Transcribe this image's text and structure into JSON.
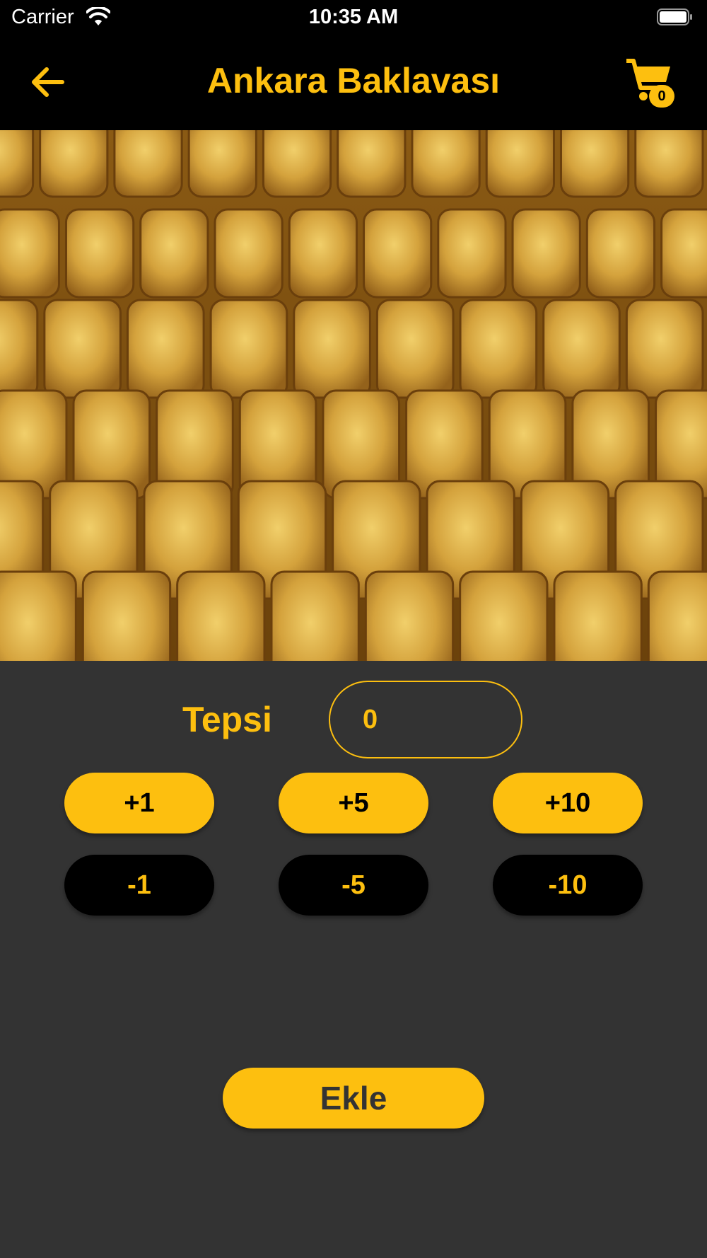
{
  "status_bar": {
    "carrier": "Carrier",
    "time": "10:35 AM",
    "wifi_icon": "wifi-icon",
    "battery_icon": "battery-icon"
  },
  "navbar": {
    "title": "Ankara Baklavası",
    "back_icon": "arrow-left-icon",
    "cart_icon": "shopping-cart-icon",
    "cart_count": "0"
  },
  "product": {
    "image": "baklava-photo"
  },
  "quantity": {
    "label": "Tepsi",
    "value": "0",
    "increase_buttons": [
      "+1",
      "+5",
      "+10"
    ],
    "decrease_buttons": [
      "-1",
      "-5",
      "-10"
    ]
  },
  "actions": {
    "add_label": "Ekle"
  },
  "colors": {
    "accent": "#FDBF0F",
    "background": "#333333",
    "bar": "#000000"
  }
}
